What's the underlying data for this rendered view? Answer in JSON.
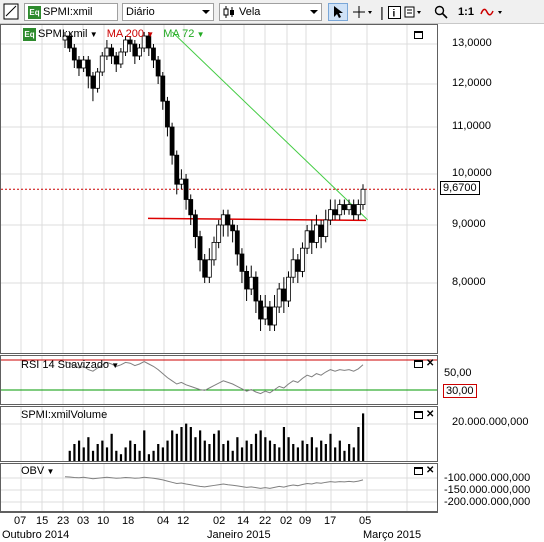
{
  "toolbar": {
    "symbol": "SPMI:xmil",
    "period": "Diário",
    "chart_type": "Vela",
    "zoom_ratio": "1:1"
  },
  "main_panel": {
    "symbol_label": "SPMI:xmil",
    "ma1_label": "MA 200",
    "ma2_label": "MA 72",
    "price_levels": [
      "13,0000",
      "12,0000",
      "11,0000",
      "10,0000",
      "9,0000",
      "8,0000"
    ],
    "current_price": "9,6700",
    "colors": {
      "ma200": "#cc0000",
      "ma72": "#33cc33",
      "hline": "#dd0000",
      "price_line": "#cc0000"
    }
  },
  "rsi_panel": {
    "label": "RSI 14 Suavizado",
    "levels": [
      "50,00"
    ],
    "marker": "30,00"
  },
  "volume_panel": {
    "label": "SPMI:xmilVolume",
    "levels": [
      "20.000.000,000"
    ]
  },
  "obv_panel": {
    "label": "OBV",
    "levels": [
      "-100.000.000,000",
      "-150.000.000,000",
      "-200.000.000,000"
    ]
  },
  "x_axis": {
    "days": [
      "07",
      "15",
      "23",
      "03",
      "10",
      "18",
      "04",
      "12",
      "02",
      "14",
      "22",
      "02",
      "09",
      "17",
      "05"
    ],
    "months": [
      "Outubro 2014",
      "Janeiro 2015",
      "Março 2015"
    ]
  },
  "chart_data": {
    "type": "candlestick",
    "title": "",
    "y_range": [
      7.2,
      13.3
    ],
    "candles": [
      [
        13.1,
        13.2,
        13.3,
        12.9
      ],
      [
        13.2,
        12.9,
        13.3,
        12.8
      ],
      [
        12.9,
        12.6,
        13.0,
        12.4
      ],
      [
        12.6,
        12.4,
        12.7,
        12.2
      ],
      [
        12.4,
        12.6,
        12.7,
        12.3
      ],
      [
        12.6,
        12.2,
        12.7,
        11.9
      ],
      [
        12.2,
        11.9,
        12.3,
        11.6
      ],
      [
        11.9,
        12.3,
        12.4,
        11.8
      ],
      [
        12.3,
        12.7,
        12.8,
        12.2
      ],
      [
        12.7,
        12.9,
        13.1,
        12.6
      ],
      [
        12.9,
        12.7,
        13.0,
        12.5
      ],
      [
        12.7,
        12.5,
        12.8,
        12.3
      ],
      [
        12.5,
        12.8,
        12.9,
        12.4
      ],
      [
        12.8,
        13.1,
        13.2,
        12.7
      ],
      [
        13.1,
        13.0,
        13.2,
        12.8
      ],
      [
        13.0,
        12.7,
        13.1,
        12.5
      ],
      [
        12.7,
        12.9,
        13.0,
        12.6
      ],
      [
        12.9,
        13.2,
        13.3,
        12.8
      ],
      [
        13.2,
        12.9,
        13.3,
        12.7
      ],
      [
        12.9,
        12.6,
        13.0,
        12.4
      ],
      [
        12.6,
        12.2,
        12.7,
        12.0
      ],
      [
        12.2,
        11.6,
        12.3,
        11.4
      ],
      [
        11.6,
        11.0,
        11.7,
        10.8
      ],
      [
        11.0,
        10.4,
        11.1,
        10.2
      ],
      [
        10.4,
        9.8,
        10.5,
        9.6
      ],
      [
        9.8,
        9.9,
        10.1,
        9.7
      ],
      [
        9.9,
        9.5,
        10.0,
        9.3
      ],
      [
        9.5,
        9.2,
        9.6,
        9.0
      ],
      [
        9.2,
        8.8,
        9.3,
        8.6
      ],
      [
        8.8,
        8.4,
        8.9,
        8.2
      ],
      [
        8.4,
        8.1,
        8.5,
        8.0
      ],
      [
        8.1,
        8.4,
        8.6,
        8.0
      ],
      [
        8.4,
        8.7,
        8.8,
        8.3
      ],
      [
        8.7,
        9.0,
        9.1,
        8.6
      ],
      [
        9.0,
        9.2,
        9.3,
        8.8
      ],
      [
        9.2,
        9.0,
        9.3,
        8.8
      ],
      [
        9.0,
        8.9,
        9.1,
        8.7
      ],
      [
        8.9,
        8.5,
        9.0,
        8.3
      ],
      [
        8.5,
        8.2,
        8.6,
        8.0
      ],
      [
        8.2,
        7.9,
        8.3,
        7.7
      ],
      [
        7.9,
        8.1,
        8.3,
        7.8
      ],
      [
        8.1,
        7.7,
        8.2,
        7.5
      ],
      [
        7.7,
        7.4,
        7.8,
        7.2
      ],
      [
        7.4,
        7.6,
        7.8,
        7.3
      ],
      [
        7.6,
        7.3,
        7.7,
        7.2
      ],
      [
        7.3,
        7.6,
        7.8,
        7.2
      ],
      [
        7.6,
        7.9,
        8.0,
        7.5
      ],
      [
        7.9,
        7.7,
        8.1,
        7.5
      ],
      [
        7.7,
        8.1,
        8.2,
        7.6
      ],
      [
        8.1,
        8.4,
        8.6,
        8.0
      ],
      [
        8.4,
        8.2,
        8.5,
        8.0
      ],
      [
        8.2,
        8.6,
        8.7,
        8.1
      ],
      [
        8.6,
        8.9,
        9.0,
        8.5
      ],
      [
        8.9,
        8.7,
        9.1,
        8.5
      ],
      [
        8.7,
        9.0,
        9.2,
        8.6
      ],
      [
        9.0,
        8.8,
        9.1,
        8.6
      ],
      [
        8.8,
        9.1,
        9.3,
        8.7
      ],
      [
        9.1,
        9.3,
        9.5,
        9.0
      ],
      [
        9.3,
        9.2,
        9.5,
        9.1
      ],
      [
        9.2,
        9.4,
        9.5,
        9.1
      ],
      [
        9.4,
        9.3,
        9.5,
        9.2
      ],
      [
        9.3,
        9.4,
        9.5,
        9.2
      ],
      [
        9.4,
        9.2,
        9.5,
        9.1
      ],
      [
        9.2,
        9.4,
        9.5,
        9.1
      ],
      [
        9.4,
        9.7,
        9.8,
        9.3
      ]
    ],
    "rsi": [
      48,
      46,
      43,
      40,
      42,
      38,
      36,
      40,
      44,
      47,
      45,
      42,
      44,
      47,
      46,
      43,
      45,
      48,
      45,
      42,
      38,
      33,
      28,
      24,
      20,
      22,
      19,
      17,
      15,
      13,
      12,
      15,
      18,
      21,
      24,
      22,
      20,
      17,
      14,
      11,
      13,
      10,
      8,
      11,
      9,
      13,
      17,
      15,
      20,
      24,
      22,
      27,
      31,
      29,
      33,
      31,
      35,
      38,
      36,
      38,
      37,
      38,
      36,
      39,
      44
    ],
    "volume": [
      0,
      3,
      5,
      6,
      4,
      7,
      3,
      5,
      6,
      4,
      8,
      3,
      2,
      4,
      6,
      5,
      3,
      9,
      2,
      3,
      5,
      4,
      6,
      9,
      8,
      10,
      11,
      10,
      7,
      9,
      6,
      5,
      8,
      9,
      5,
      6,
      3,
      7,
      4,
      6,
      5,
      8,
      9,
      7,
      6,
      5,
      4,
      10,
      7,
      5,
      4,
      6,
      5,
      7,
      4,
      6,
      5,
      8,
      4,
      6,
      3,
      5,
      4,
      10,
      14
    ],
    "obv": [
      -95,
      -96,
      -98,
      -99,
      -97,
      -100,
      -103,
      -101,
      -99,
      -97,
      -99,
      -101,
      -100,
      -98,
      -99,
      -101,
      -100,
      -97,
      -99,
      -101,
      -104,
      -108,
      -113,
      -118,
      -123,
      -121,
      -125,
      -128,
      -132,
      -135,
      -137,
      -134,
      -131,
      -128,
      -125,
      -128,
      -130,
      -133,
      -136,
      -139,
      -137,
      -140,
      -143,
      -140,
      -143,
      -139,
      -135,
      -138,
      -133,
      -129,
      -132,
      -127,
      -123,
      -125,
      -120,
      -122,
      -118,
      -115,
      -117,
      -115,
      -116,
      -114,
      -116,
      -113,
      -108
    ],
    "hline": 9.13,
    "ma72_line": {
      "from": [
        13.3,
        8
      ],
      "to": [
        9.1,
        65
      ]
    }
  }
}
